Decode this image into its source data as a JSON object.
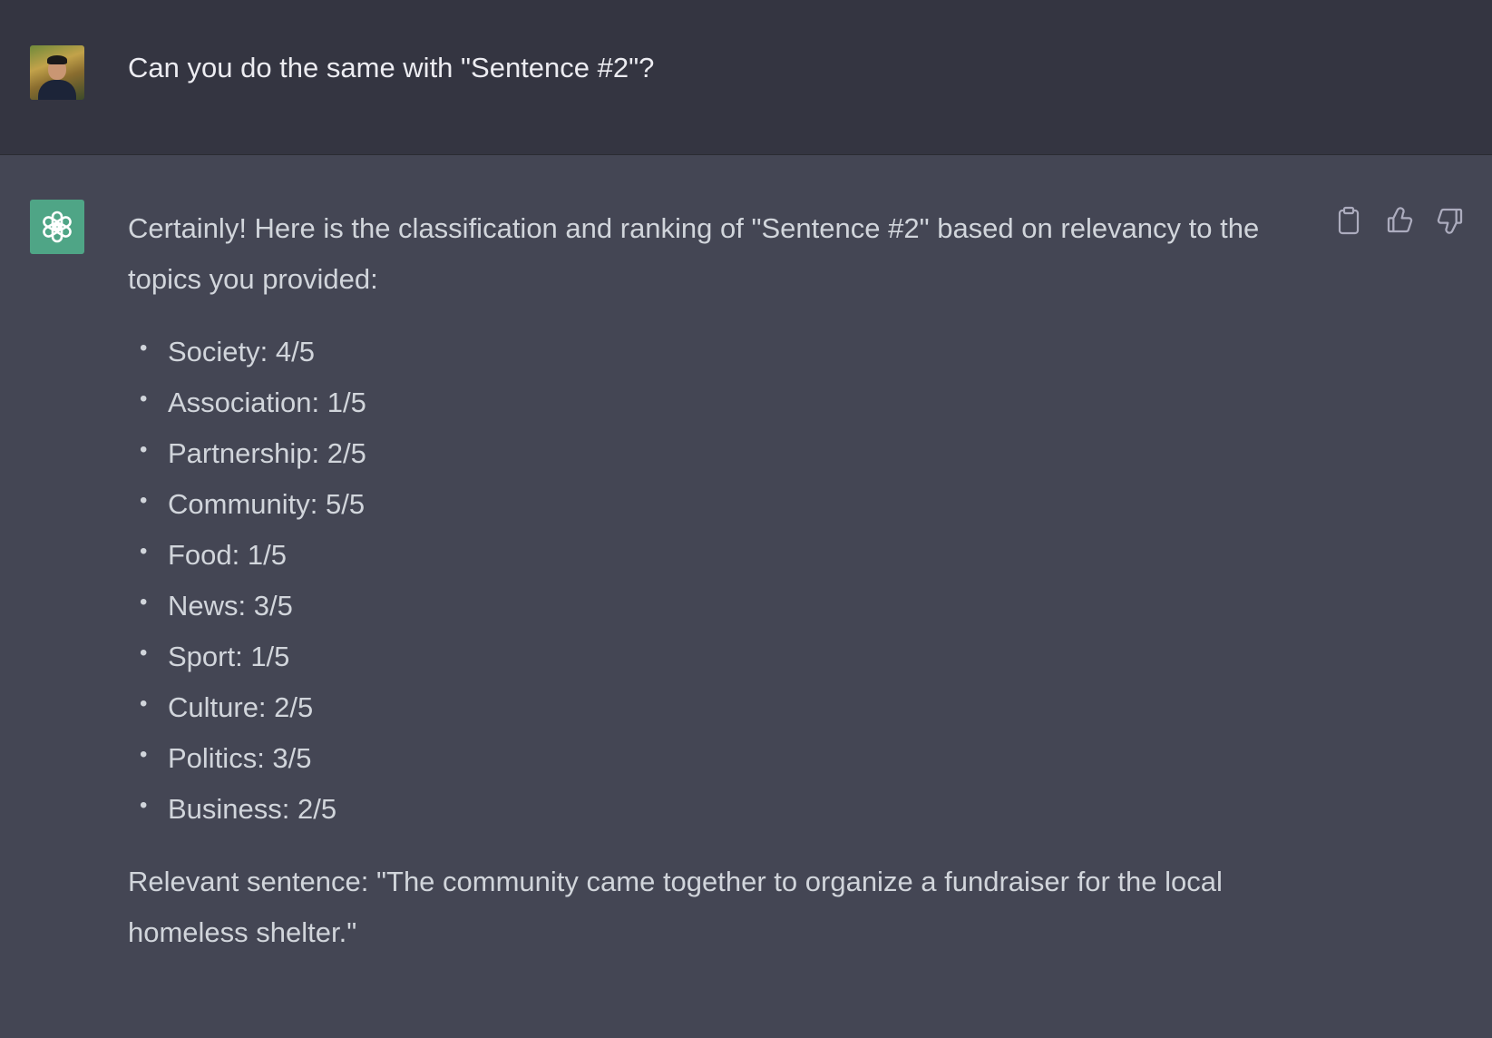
{
  "user": {
    "message": "Can you do the same with \"Sentence #2\"?"
  },
  "assistant": {
    "intro": "Certainly! Here is the classification and ranking of \"Sentence #2\" based on relevancy to the topics you provided:",
    "topics": [
      {
        "text": "Society: 4/5"
      },
      {
        "text": "Association: 1/5"
      },
      {
        "text": "Partnership: 2/5"
      },
      {
        "text": "Community: 5/5"
      },
      {
        "text": "Food: 1/5"
      },
      {
        "text": "News: 3/5"
      },
      {
        "text": "Sport: 1/5"
      },
      {
        "text": "Culture: 2/5"
      },
      {
        "text": "Politics: 3/5"
      },
      {
        "text": "Business: 2/5"
      }
    ],
    "conclusion": "Relevant sentence: \"The community came together to organize a fundraiser for the local homeless shelter.\""
  },
  "actions": {
    "icons": [
      "clipboard-icon",
      "thumbs-up-icon",
      "thumbs-down-icon"
    ]
  },
  "colors": {
    "user_bg": "#343541",
    "assistant_bg": "#444654",
    "bot_avatar": "#4fa586",
    "text": "#d1d5db"
  }
}
